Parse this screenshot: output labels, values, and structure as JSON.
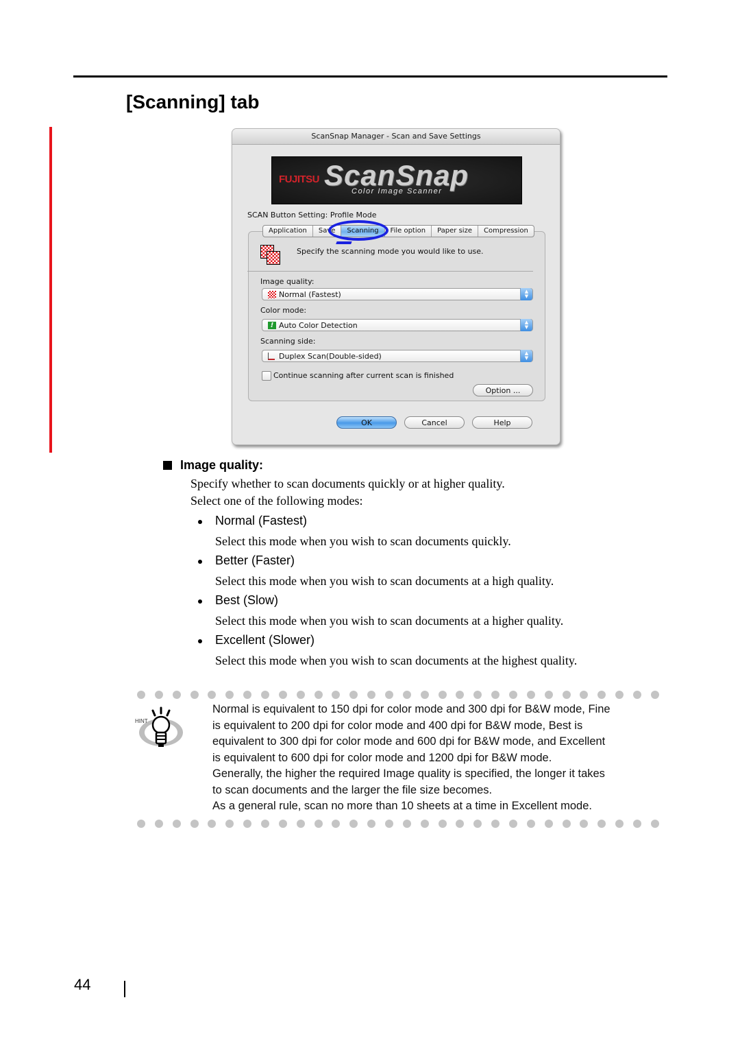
{
  "section_title": "[Scanning] tab",
  "dialog": {
    "title": "ScanSnap Manager - Scan and Save Settings",
    "banner": {
      "brand": "FUJITSU",
      "product": "ScanSnap",
      "subtitle": "Color Image Scanner"
    },
    "profile_label": "SCAN Button Setting: Profile Mode",
    "tabs": [
      {
        "label": "Application",
        "active": false
      },
      {
        "label": "Save",
        "active": false
      },
      {
        "label": "Scanning",
        "active": true
      },
      {
        "label": "File option",
        "active": false
      },
      {
        "label": "Paper size",
        "active": false
      },
      {
        "label": "Compression",
        "active": false
      }
    ],
    "description": "Specify the scanning mode you would like to use.",
    "image_quality": {
      "label": "Image quality:",
      "value": "Normal  (Fastest)",
      "icon": "checkered-quality-icon"
    },
    "color_mode": {
      "label": "Color mode:",
      "value": "Auto Color Detection",
      "icon": "auto-color-icon"
    },
    "scanning_side": {
      "label": "Scanning side:",
      "value": "Duplex Scan(Double-sided)",
      "icon": "duplex-icon"
    },
    "continue_checkbox": {
      "label": "Continue scanning after current scan is finished",
      "checked": false
    },
    "option_button": "Option ...",
    "ok_button": "OK",
    "cancel_button": "Cancel",
    "help_button": "Help",
    "highlight_color": "#1a22e0"
  },
  "image_quality_section": {
    "heading": "Image quality:",
    "intro": [
      "Specify whether to scan documents quickly or at higher quality.",
      "Select one of the following modes:"
    ],
    "modes": [
      {
        "name": "Normal (Fastest)",
        "description": "Select this mode when you wish to scan documents quickly."
      },
      {
        "name": "Better (Faster)",
        "description": "Select this mode when you wish to scan documents at a high quality."
      },
      {
        "name": "Best (Slow)",
        "description": "Select this mode when you wish to scan documents at a higher quality."
      },
      {
        "name": "Excellent (Slower)",
        "description": "Select this mode when you wish to scan documents at the highest quality."
      }
    ]
  },
  "hint": {
    "label": "HINT",
    "lines": [
      "Normal is equivalent to 150 dpi for color mode and 300 dpi for B&W mode, Fine",
      "is equivalent to 200 dpi for color mode and 400 dpi for B&W mode, Best is",
      "equivalent to 300 dpi for color mode and 600 dpi for B&W mode, and Excellent",
      "is equivalent to 600 dpi for color mode and 1200 dpi for B&W mode.",
      "Generally, the higher the required Image quality is specified, the longer it takes",
      "to scan documents and the larger the file size becomes.",
      "As a general rule, scan no more than 10 sheets at a time in Excellent mode."
    ]
  },
  "page_number": "44",
  "accent_color": "#e8141c"
}
